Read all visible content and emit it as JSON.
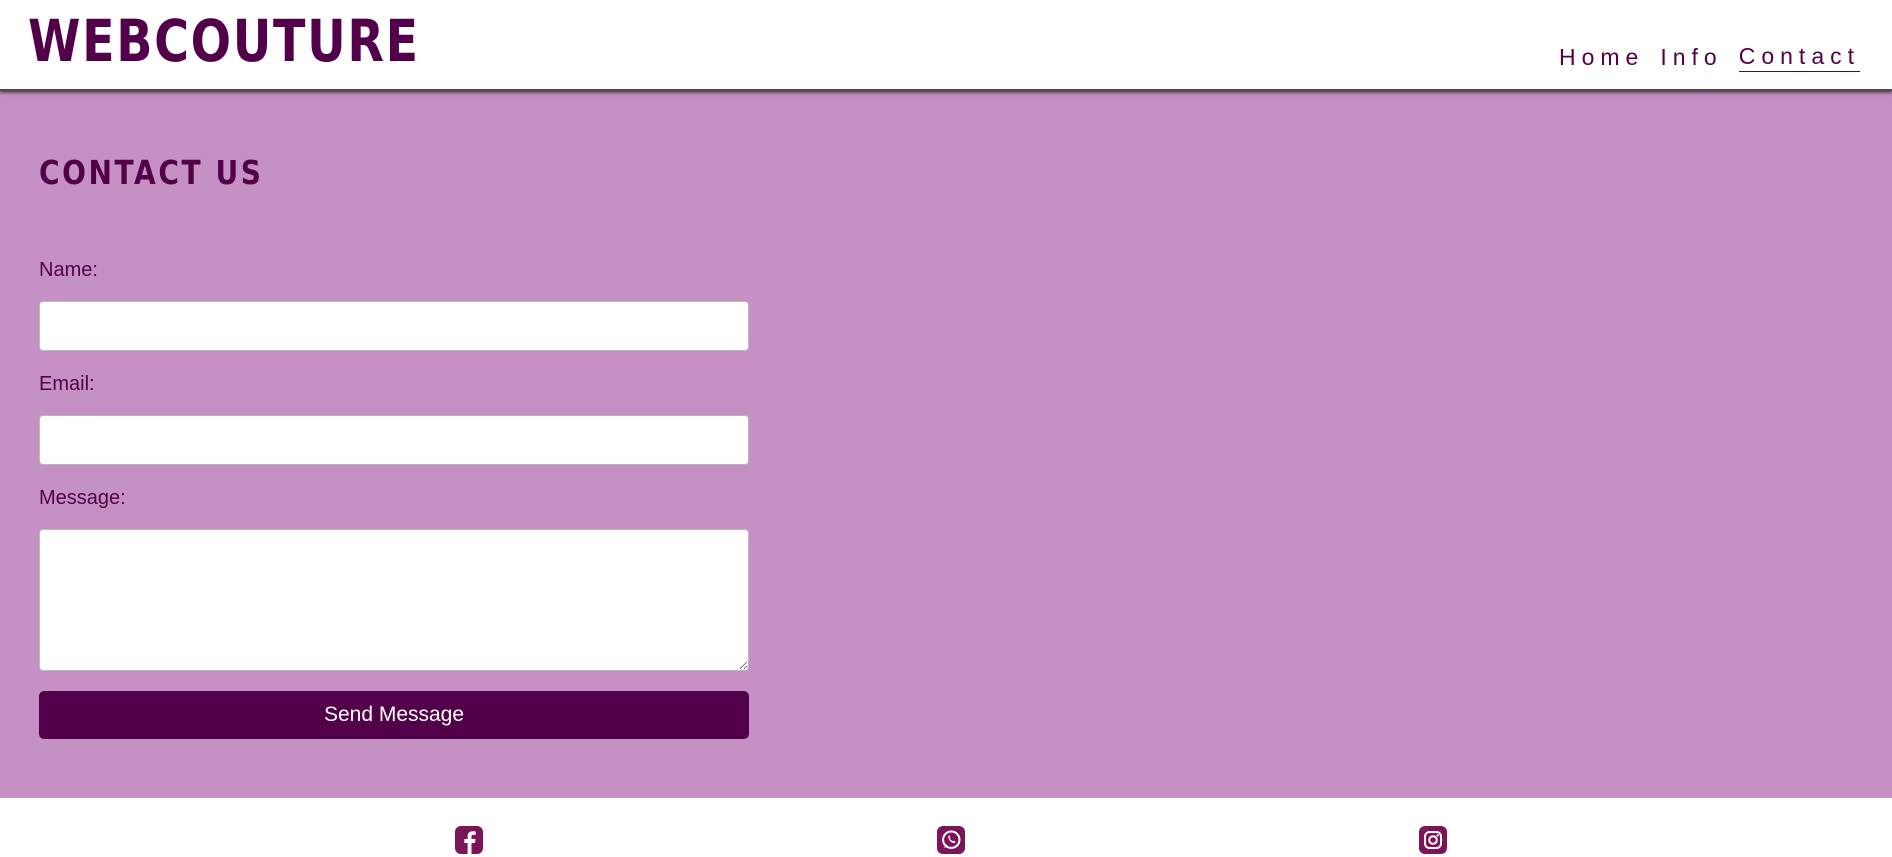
{
  "header": {
    "logo": "WEBCOUTURE",
    "nav": [
      {
        "label": "Home"
      },
      {
        "label": "Info"
      },
      {
        "label": "Contact",
        "active": true
      }
    ]
  },
  "contact": {
    "title": "CONTACT US",
    "name_label": "Name:",
    "name_value": "",
    "email_label": "Email:",
    "email_value": "",
    "message_label": "Message:",
    "message_value": "",
    "submit_label": "Send Message"
  },
  "footer": {
    "social": [
      {
        "icon": "facebook-icon"
      },
      {
        "icon": "whatsapp-icon"
      },
      {
        "icon": "instagram-icon"
      }
    ]
  },
  "colors": {
    "brand": "#520049",
    "background": "#c590c3",
    "surface": "#ffffff",
    "social_icon": "#7b1458"
  }
}
